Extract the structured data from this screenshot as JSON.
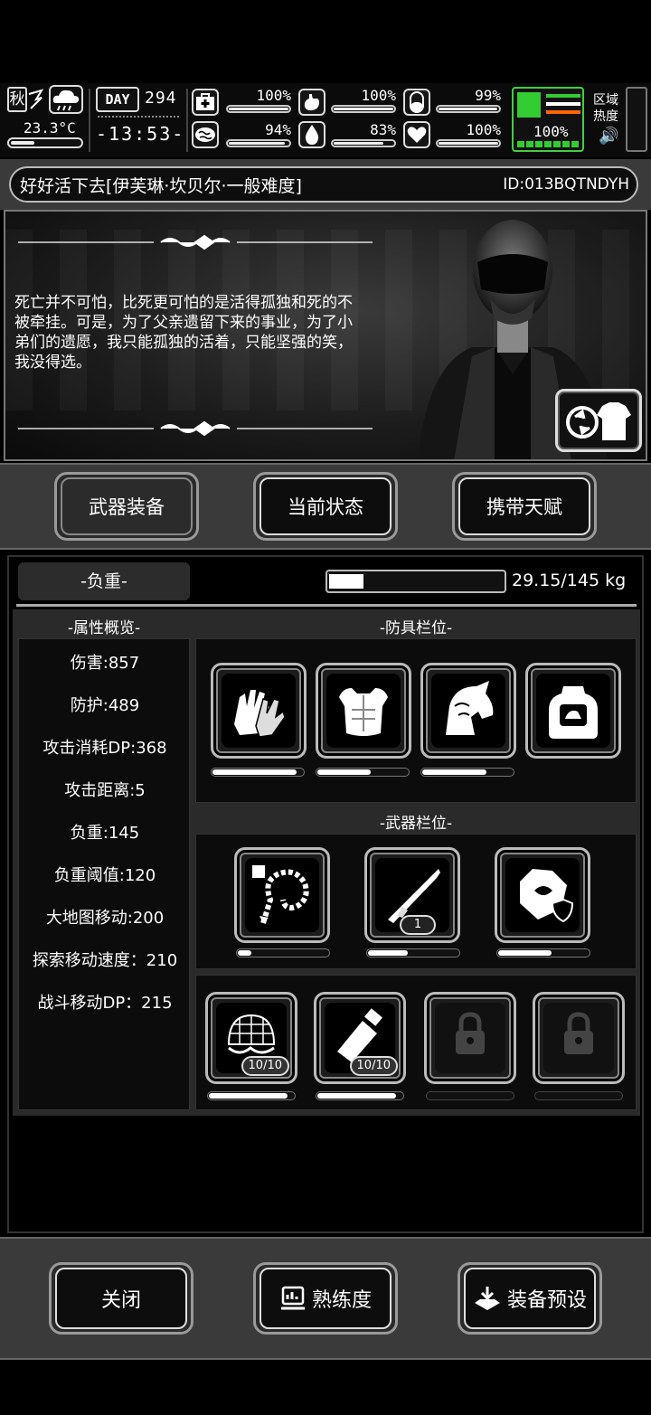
{
  "hud": {
    "season": "秋",
    "temperature": "23.3°C",
    "day_label": "DAY",
    "day_number": "294",
    "clock": "-13:53-",
    "stats": [
      {
        "icon": "medkit-icon",
        "value": "100%",
        "fraction": 1.0
      },
      {
        "icon": "stomach-icon",
        "value": "100%",
        "fraction": 1.0
      },
      {
        "icon": "pill-icon",
        "value": "99%",
        "fraction": 0.99
      },
      {
        "icon": "brain-icon",
        "value": "94%",
        "fraction": 0.94
      },
      {
        "icon": "water-drop-icon",
        "value": "83%",
        "fraction": 0.83
      },
      {
        "icon": "heart-icon",
        "value": "100%",
        "fraction": 1.0
      }
    ],
    "zone": {
      "percent": "100%",
      "label": "区域热度",
      "colors": {
        "foot": "#33cc33",
        "line1": "#33cc33",
        "line2": "#ffffff",
        "line3": "#ff6600"
      }
    }
  },
  "title": {
    "text": "好好活下去[伊芙琳·坎贝尔·一般难度]",
    "id": "ID:013BQTNDYH"
  },
  "story": {
    "text": "死亡并不可怕，比死更可怕的是活得孤独和死的不被牵挂。可是，为了父亲遗留下来的事业，为了小弟们的遗愿，我只能孤独的活着，只能坚强的笑，我没得选。"
  },
  "tabs": [
    {
      "label": "武器装备",
      "active": true
    },
    {
      "label": "当前状态",
      "active": false
    },
    {
      "label": "携带天赋",
      "active": false
    }
  ],
  "load": {
    "label": "-负重-",
    "value": "29.15/145 kg",
    "fraction": 0.2
  },
  "headings": {
    "attrs": "-属性概览-",
    "armor": "-防具栏位-",
    "weapons": "-武器栏位-"
  },
  "attributes": [
    "伤害:857",
    "防护:489",
    "攻击消耗DP:368",
    "攻击距离:5",
    "负重:145",
    "负重阈值:120",
    "大地图移动:200",
    "探索移动速度：210",
    "战斗移动DP：215"
  ],
  "armor_slots": [
    {
      "name": "gloves",
      "durability": 0.95
    },
    {
      "name": "body-armor",
      "durability": 0.6
    },
    {
      "name": "horse-helmet",
      "durability": 0.72
    },
    {
      "name": "backpack",
      "durability": 0
    }
  ],
  "weapon_slots": [
    {
      "name": "spine-whip",
      "durability": 0.15
    },
    {
      "name": "rocket-launcher",
      "durability": 0.45,
      "count": "1"
    },
    {
      "name": "shield-gauntlet",
      "durability": 0.6
    }
  ],
  "tool_slots": [
    {
      "name": "net",
      "count": "10/10",
      "durability": 0.95,
      "locked": false
    },
    {
      "name": "canister",
      "count": "10/10",
      "durability": 0.95,
      "locked": false
    },
    {
      "name": "locked-slot",
      "locked": true
    },
    {
      "name": "locked-slot",
      "locked": true
    }
  ],
  "bottom": {
    "close": "关闭",
    "proficiency": "熟练度",
    "preset": "装备预设"
  }
}
